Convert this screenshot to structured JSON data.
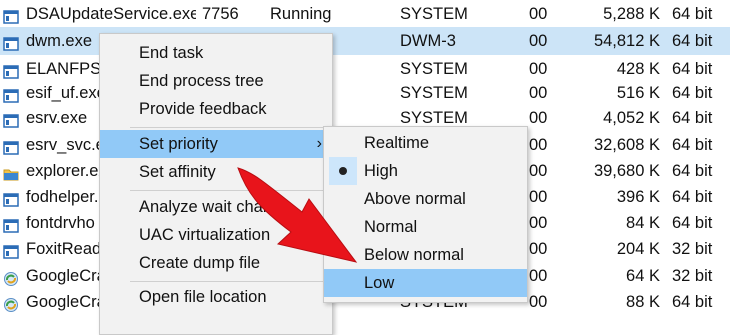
{
  "process_table": {
    "rows": [
      {
        "name": "DSAUpdateService.exe",
        "pid": "7756",
        "status": "Running",
        "user": "SYSTEM",
        "cpu": "00",
        "memory": "5,288 K",
        "arch": "64 bit",
        "icon": "service-window-icon"
      },
      {
        "name": "dwm.exe",
        "pid": "",
        "status": "",
        "user": "DWM-3",
        "cpu": "00",
        "memory": "54,812 K",
        "arch": "64 bit",
        "icon": "service-window-icon",
        "selected": true
      },
      {
        "name": "ELANFPSe",
        "pid": "",
        "status": "",
        "user": "SYSTEM",
        "cpu": "00",
        "memory": "428 K",
        "arch": "64 bit",
        "icon": "service-window-icon"
      },
      {
        "name": "esif_uf.exe",
        "pid": "",
        "status": "",
        "user": "SYSTEM",
        "cpu": "00",
        "memory": "516 K",
        "arch": "64 bit",
        "icon": "service-window-icon"
      },
      {
        "name": "esrv.exe",
        "pid": "",
        "status": "",
        "user": "SYSTEM",
        "cpu": "00",
        "memory": "4,052 K",
        "arch": "64 bit",
        "icon": "service-window-icon"
      },
      {
        "name": "esrv_svc.ex",
        "pid": "",
        "status": "",
        "user": "",
        "cpu": "00",
        "memory": "32,608 K",
        "arch": "64 bit",
        "icon": "service-window-icon"
      },
      {
        "name": "explorer.ex",
        "pid": "",
        "status": "",
        "user": "",
        "cpu": "00",
        "memory": "39,680 K",
        "arch": "64 bit",
        "icon": "folder-icon"
      },
      {
        "name": "fodhelper.",
        "pid": "",
        "status": "",
        "user": "",
        "cpu": "00",
        "memory": "396 K",
        "arch": "64 bit",
        "icon": "service-window-icon"
      },
      {
        "name": "fontdrvho",
        "pid": "",
        "status": "",
        "user": "",
        "cpu": "00",
        "memory": "84 K",
        "arch": "64 bit",
        "icon": "service-window-icon"
      },
      {
        "name": "FoxitReade",
        "pid": "",
        "status": "",
        "user": "",
        "cpu": "00",
        "memory": "204 K",
        "arch": "32 bit",
        "icon": "service-window-icon"
      },
      {
        "name": "GoogleCra",
        "pid": "",
        "status": "",
        "user": "",
        "cpu": "00",
        "memory": "64 K",
        "arch": "32 bit",
        "icon": "google-update-icon"
      },
      {
        "name": "GoogleCra",
        "pid": "",
        "status": "",
        "user": "SYSTEM",
        "cpu": "00",
        "memory": "88 K",
        "arch": "64 bit",
        "icon": "google-update-icon"
      }
    ]
  },
  "context_menu": {
    "items": [
      {
        "label": "End task"
      },
      {
        "label": "End process tree"
      },
      {
        "label": "Provide feedback"
      },
      {
        "label": "Set priority",
        "has_submenu": true,
        "highlighted": true
      },
      {
        "label": "Set affinity"
      },
      {
        "label": "Analyze wait chain"
      },
      {
        "label": "UAC virtualization"
      },
      {
        "label": "Create dump file"
      },
      {
        "label": "Open file location"
      }
    ],
    "submenu_chevron": "›"
  },
  "priority_submenu": {
    "items": [
      {
        "label": "Realtime"
      },
      {
        "label": "High",
        "checked": true
      },
      {
        "label": "Above normal"
      },
      {
        "label": "Normal"
      },
      {
        "label": "Below normal"
      },
      {
        "label": "Low",
        "highlighted": true
      }
    ]
  },
  "colors": {
    "selected_row": "#cce4f7",
    "menu_highlight": "#91c9f7",
    "menu_background": "#f2f2f2",
    "annotation_arrow": "#e8141b"
  }
}
